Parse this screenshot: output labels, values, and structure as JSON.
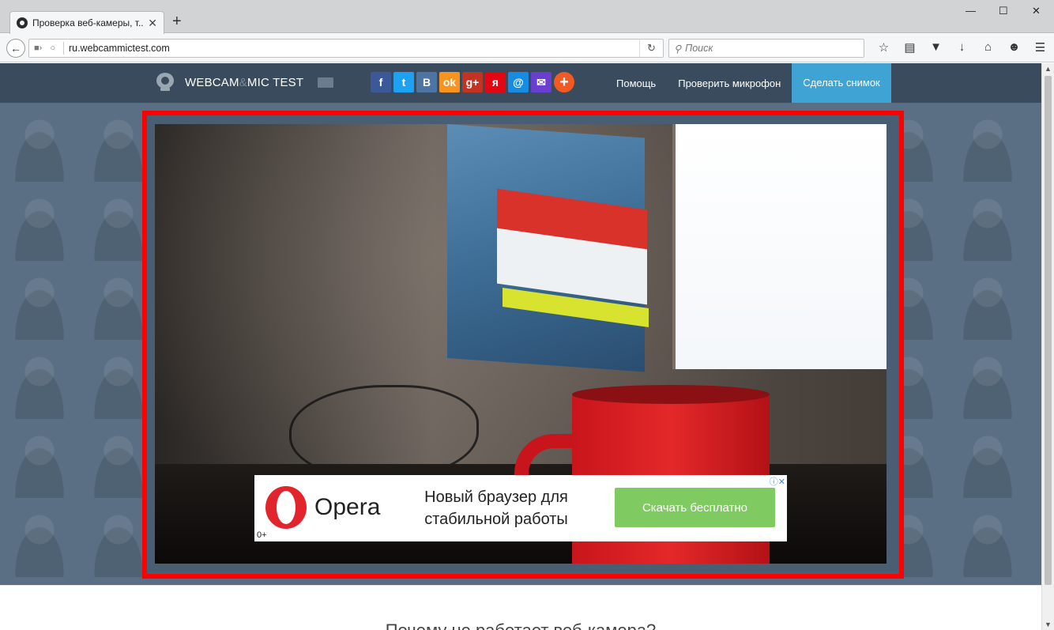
{
  "browser": {
    "tab_title": "Проверка веб-камеры, т...",
    "tab_close": "✕",
    "new_tab": "+",
    "url": "ru.webcammictest.com",
    "search_placeholder": "Поиск",
    "window_controls": [
      "—",
      "☐",
      "✕"
    ],
    "toolbar_icons": [
      "star-icon",
      "reading-list-icon",
      "pocket-icon",
      "download-icon",
      "home-icon",
      "chat-icon",
      "menu-icon"
    ]
  },
  "site": {
    "logo_part1": "WEBCAM",
    "logo_amp": "&",
    "logo_part2": "MIC TEST",
    "share": [
      {
        "name": "facebook",
        "label": "f",
        "color": "#3b5998"
      },
      {
        "name": "twitter",
        "label": "t",
        "color": "#1da1f2"
      },
      {
        "name": "vkontakte",
        "label": "B",
        "color": "#4c75a3"
      },
      {
        "name": "odnoklassniki",
        "label": "ok",
        "color": "#f7931e"
      },
      {
        "name": "google-plus",
        "label": "g+",
        "color": "#c23321"
      },
      {
        "name": "moimir",
        "label": "я",
        "color": "#e30613"
      },
      {
        "name": "mailru",
        "label": "@",
        "color": "#168de2"
      },
      {
        "name": "email",
        "label": "✉",
        "color": "#6a3fd0"
      },
      {
        "name": "more",
        "label": "+",
        "color": "#f15a22"
      }
    ],
    "menu": {
      "help": "Помощь",
      "mic_test": "Проверить микрофон",
      "snapshot": "Сделать снимок"
    }
  },
  "ad": {
    "brand": "Opera",
    "text": "Новый браузер для стабильной работы",
    "cta": "Скачать бесплатно",
    "age": "0+",
    "close": "ⓘ✕"
  },
  "below": {
    "heading": "Почему не работает веб-камера?"
  }
}
